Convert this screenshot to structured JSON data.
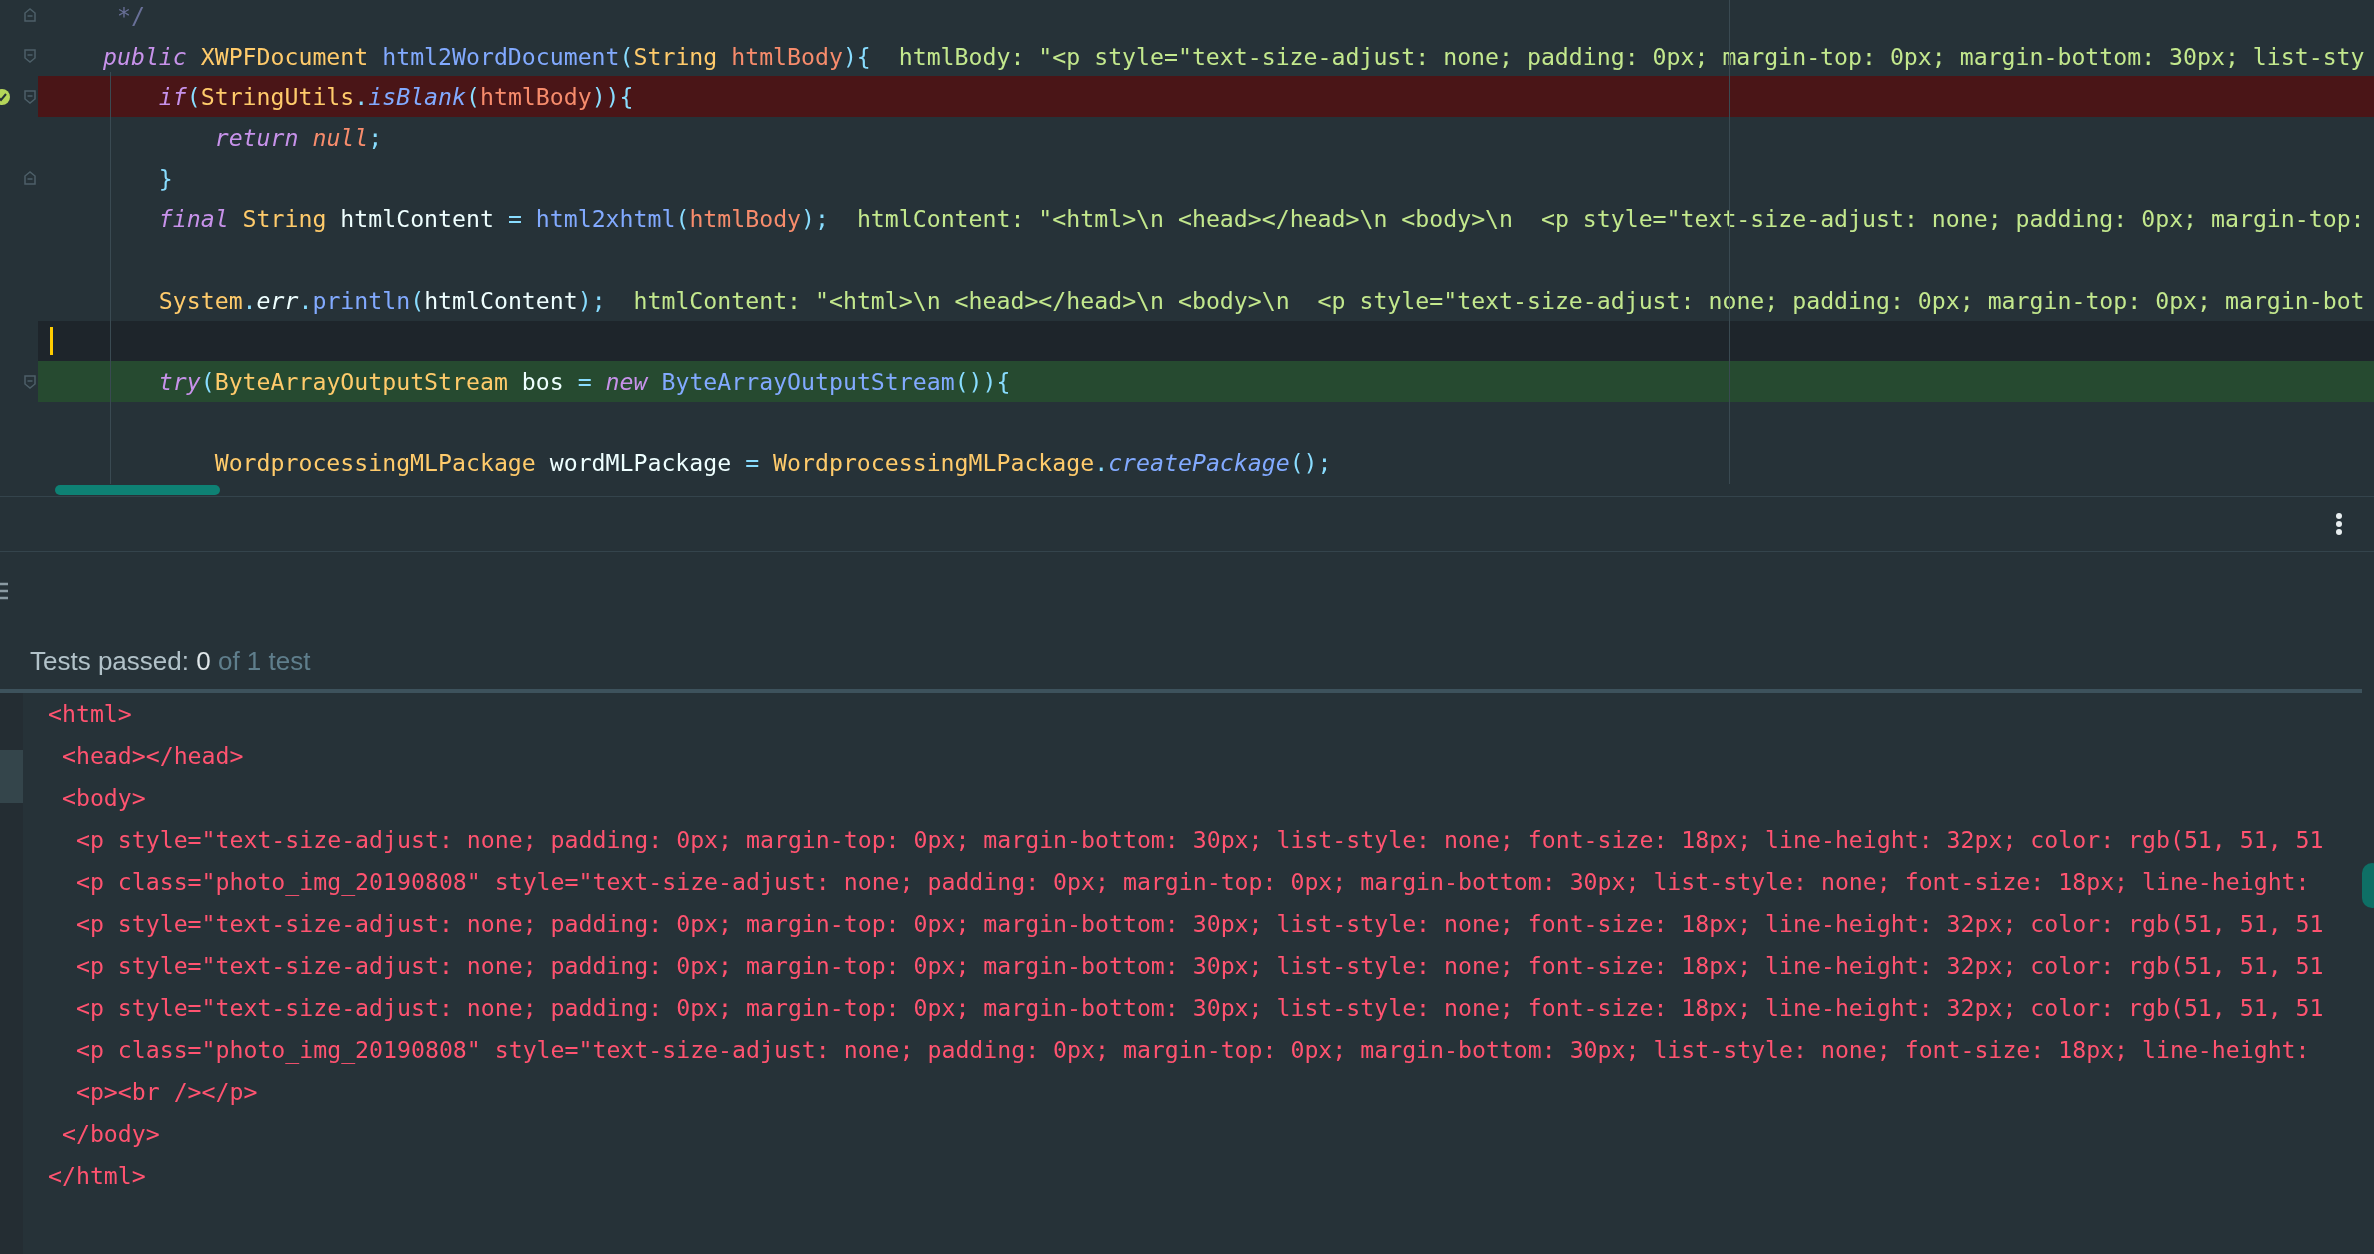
{
  "editor": {
    "lines": [
      {
        "kind": "code",
        "fold_close": true,
        "tokens": [
          {
            "text": " */",
            "color": "#697098"
          }
        ]
      },
      {
        "kind": "code",
        "fold_open": true,
        "tokens": [
          {
            "text": "*public*",
            "color": "#c792ea"
          },
          {
            "text": " XWPFDocument",
            "color": "#ffcb6b"
          },
          {
            "text": " html2WordDocument",
            "color": "#82aaff"
          },
          {
            "text": "(",
            "color": "#89ddff"
          },
          {
            "text": "String",
            "color": "#ffcb6b"
          },
          {
            "text": " htmlBody",
            "color": "#f78c6c"
          },
          {
            "text": "){",
            "color": "#89ddff"
          }
        ],
        "hint": "htmlBody: \"<p style=\"text-size-adjust: none; padding: 0px; margin-top: 0px; margin-bottom: 30px; list-sty"
      },
      {
        "kind": "code",
        "fold_open": true,
        "breakpoint": true,
        "tokens": [
          {
            "text": "    *if*",
            "color": "#c792ea"
          },
          {
            "text": "(",
            "color": "#89ddff"
          },
          {
            "text": "StringUtils",
            "color": "#ffcb6b"
          },
          {
            "text": ".",
            "color": "#89ddff"
          },
          {
            "text": "*isBlank*",
            "color": "#82aaff"
          },
          {
            "text": "(",
            "color": "#89ddff"
          },
          {
            "text": "htmlBody",
            "color": "#f78c6c"
          },
          {
            "text": ")){",
            "color": "#89ddff"
          }
        ]
      },
      {
        "kind": "code",
        "tokens": [
          {
            "text": "        *return*",
            "color": "#c792ea"
          },
          {
            "text": " *null*",
            "color": "#f78c6c"
          },
          {
            "text": ";",
            "color": "#89ddff"
          }
        ]
      },
      {
        "kind": "code",
        "fold_close": true,
        "tokens": [
          {
            "text": "    }",
            "color": "#89ddff"
          }
        ]
      },
      {
        "kind": "code",
        "tokens": [
          {
            "text": "    *final*",
            "color": "#c792ea"
          },
          {
            "text": " String",
            "color": "#ffcb6b"
          },
          {
            "text": " htmlContent",
            "color": "#eeffff"
          },
          {
            "text": " =",
            "color": "#89ddff"
          },
          {
            "text": " html2xhtml",
            "color": "#82aaff"
          },
          {
            "text": "(",
            "color": "#89ddff"
          },
          {
            "text": "htmlBody",
            "color": "#f78c6c"
          },
          {
            "text": ");",
            "color": "#89ddff"
          }
        ],
        "hint": "htmlContent: \"<html>\\n <head></head>\\n <body>\\n  <p style=\"text-size-adjust: none; padding: 0px; margin-top:"
      },
      {
        "kind": "blank"
      },
      {
        "kind": "code",
        "tokens": [
          {
            "text": "    System",
            "color": "#ffcb6b"
          },
          {
            "text": ".",
            "color": "#89ddff"
          },
          {
            "text": "*err*",
            "color": "#eeffff"
          },
          {
            "text": ".",
            "color": "#89ddff"
          },
          {
            "text": "println",
            "color": "#82aaff"
          },
          {
            "text": "(",
            "color": "#89ddff"
          },
          {
            "text": "htmlContent",
            "color": "#eeffff"
          },
          {
            "text": ");",
            "color": "#89ddff"
          }
        ],
        "hint": "htmlContent: \"<html>\\n <head></head>\\n <body>\\n  <p style=\"text-size-adjust: none; padding: 0px; margin-top: 0px; margin-bot"
      },
      {
        "kind": "blank",
        "current": true,
        "caret": true
      },
      {
        "kind": "code",
        "fold_open": true,
        "executing": true,
        "tokens": [
          {
            "text": "    *try*",
            "color": "#c792ea"
          },
          {
            "text": "(",
            "color": "#89ddff"
          },
          {
            "text": "ByteArrayOutputStream",
            "color": "#ffcb6b"
          },
          {
            "text": " bos",
            "color": "#eeffff"
          },
          {
            "text": " =",
            "color": "#89ddff"
          },
          {
            "text": " *new*",
            "color": "#c792ea"
          },
          {
            "text": " ByteArrayOutputStream",
            "color": "#82aaff"
          },
          {
            "text": "()){",
            "color": "#89ddff"
          }
        ]
      },
      {
        "kind": "blank"
      },
      {
        "kind": "code",
        "tokens": [
          {
            "text": "        WordprocessingMLPackage",
            "color": "#ffcb6b"
          },
          {
            "text": " wordMLPackage",
            "color": "#eeffff"
          },
          {
            "text": " =",
            "color": "#89ddff"
          },
          {
            "text": " WordprocessingMLPackage",
            "color": "#ffcb6b"
          },
          {
            "text": ".",
            "color": "#89ddff"
          },
          {
            "text": "*createPackage*",
            "color": "#82aaff"
          },
          {
            "text": "();",
            "color": "#89ddff"
          }
        ]
      }
    ]
  },
  "tests": {
    "label": "Tests passed:",
    "passed": "0",
    "total": "of 1 test"
  },
  "console": {
    "lines": [
      "<html>",
      " <head></head>",
      " <body>",
      "  <p style=\"text-size-adjust: none; padding: 0px; margin-top: 0px; margin-bottom: 30px; list-style: none; font-size: 18px; line-height: 32px; color: rgb(51, 51, 51",
      "  <p class=\"photo_img_20190808\" style=\"text-size-adjust: none; padding: 0px; margin-top: 0px; margin-bottom: 30px; list-style: none; font-size: 18px; line-height:",
      "  <p style=\"text-size-adjust: none; padding: 0px; margin-top: 0px; margin-bottom: 30px; list-style: none; font-size: 18px; line-height: 32px; color: rgb(51, 51, 51",
      "  <p style=\"text-size-adjust: none; padding: 0px; margin-top: 0px; margin-bottom: 30px; list-style: none; font-size: 18px; line-height: 32px; color: rgb(51, 51, 51",
      "  <p style=\"text-size-adjust: none; padding: 0px; margin-top: 0px; margin-bottom: 30px; list-style: none; font-size: 18px; line-height: 32px; color: rgb(51, 51, 51",
      "  <p class=\"photo_img_20190808\" style=\"text-size-adjust: none; padding: 0px; margin-top: 0px; margin-bottom: 30px; list-style: none; font-size: 18px; line-height:",
      "  <p><br /></p>",
      " </body>",
      "</html>"
    ]
  }
}
